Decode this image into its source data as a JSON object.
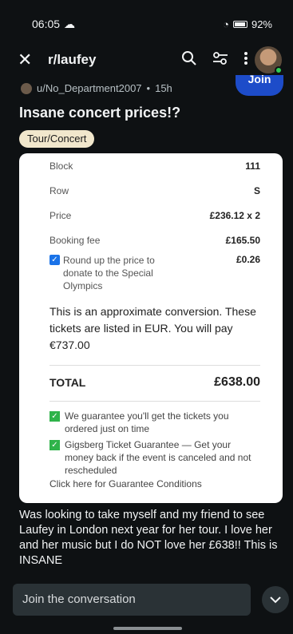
{
  "status": {
    "time": "06:05",
    "battery": "92%"
  },
  "header": {
    "subreddit": "r/laufey"
  },
  "post": {
    "author": "u/No_Department2007",
    "age": "15h",
    "join_label": "Join",
    "title": "Insane concert prices!?",
    "flair": "Tour/Concert",
    "body": "Was looking to take myself and my friend to see Laufey in London next year for her tour. I love her and her music but I do NOT love her £638!! This is INSANE"
  },
  "ticket": {
    "rows": [
      {
        "label": "Block",
        "value": "111"
      },
      {
        "label": "Row",
        "value": "S"
      },
      {
        "label": "Price",
        "value": "£236.12 x 2"
      },
      {
        "label": "Booking fee",
        "value": "£165.50"
      }
    ],
    "donate_label": "Round up the price to donate to the Special Olympics",
    "donate_value": "£0.26",
    "conversion_note": "This is an approximate conversion. These tickets are listed in EUR. You will pay €737.00",
    "total_label": "TOTAL",
    "total_value": "£638.00",
    "guarantees": [
      "We guarantee you'll get the tickets you ordered just on time",
      "Gigsberg Ticket Guarantee — Get your money back if the event is canceled and not rescheduled"
    ],
    "cutoff_text": "Click here for Guarantee Conditions"
  },
  "footer": {
    "comment_placeholder": "Join the conversation"
  }
}
